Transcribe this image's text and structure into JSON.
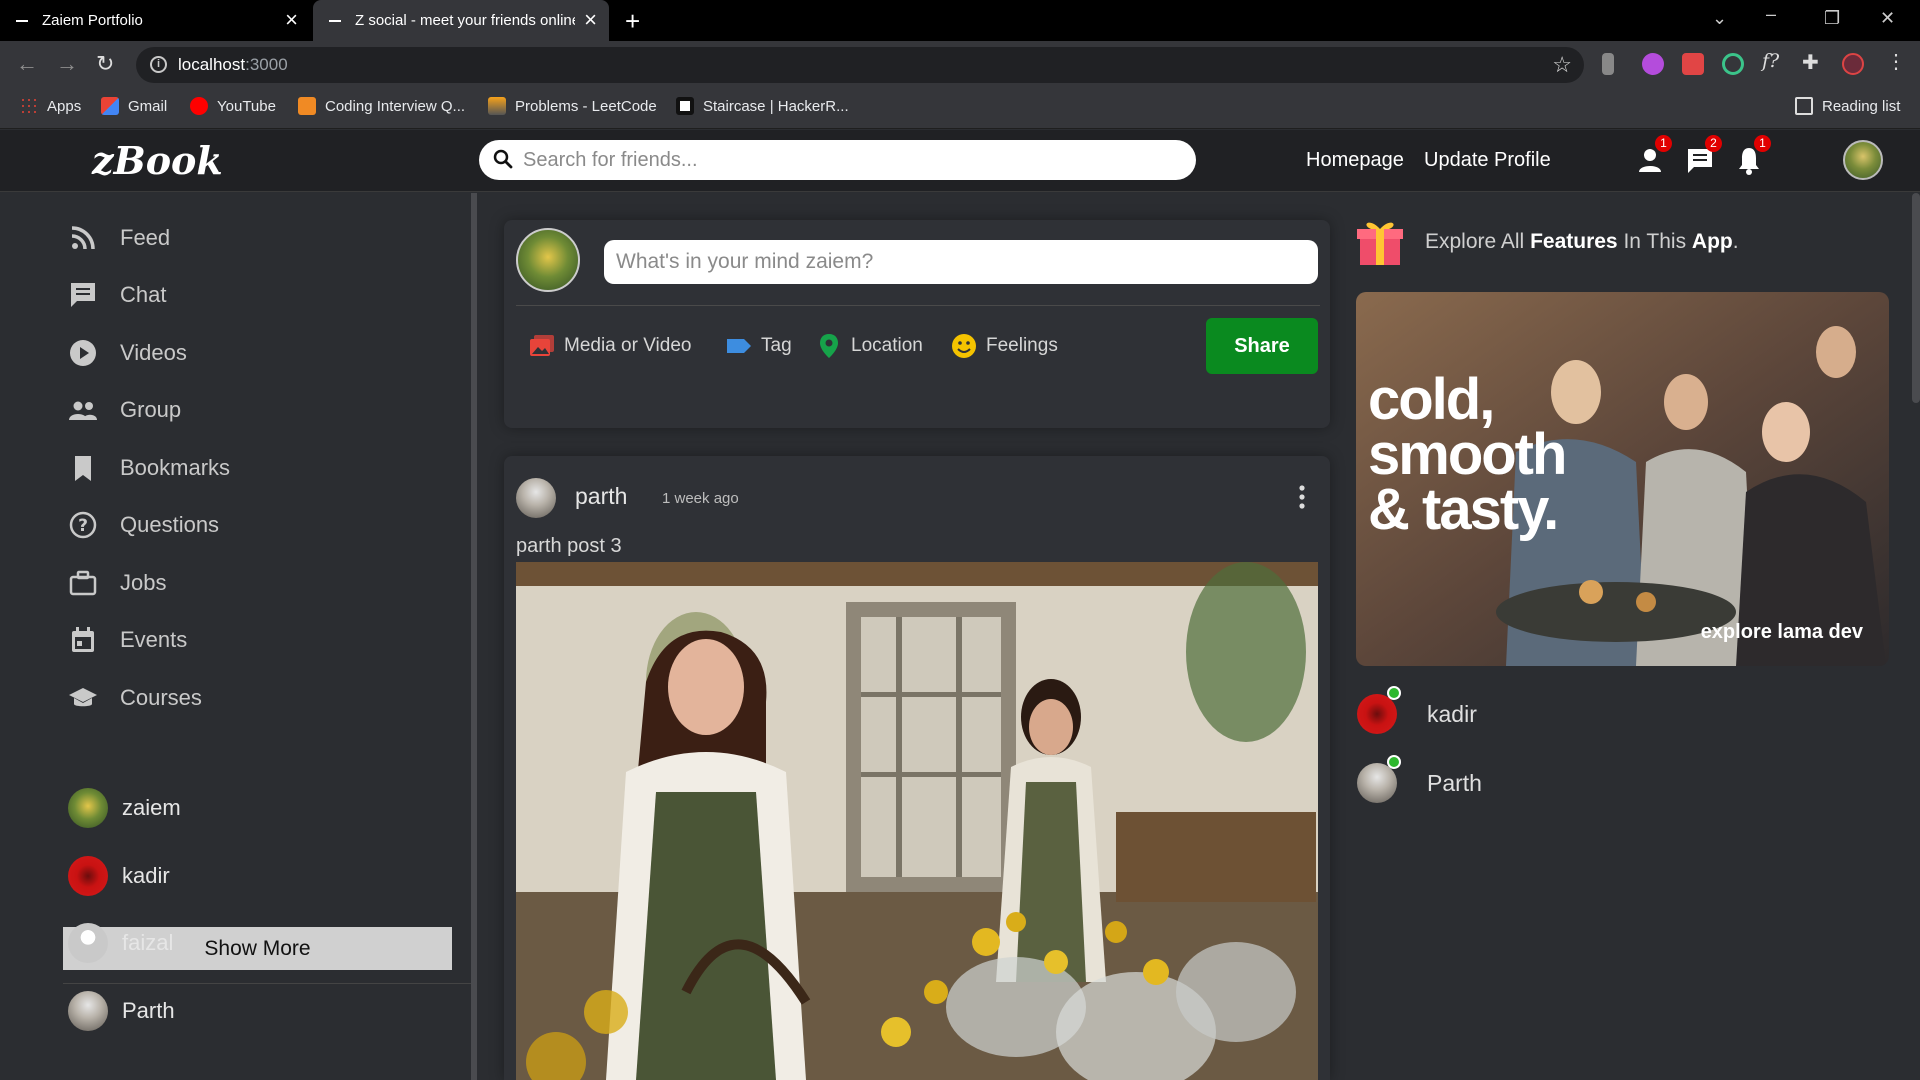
{
  "browser": {
    "tabs": [
      {
        "title": "Zaiem Portfolio"
      },
      {
        "title": "Z social - meet your friends online"
      }
    ],
    "url_host": "localhost",
    "url_port": ":3000",
    "bookmarks": [
      {
        "label": "Apps"
      },
      {
        "label": "Gmail"
      },
      {
        "label": "YouTube"
      },
      {
        "label": "Coding Interview Q..."
      },
      {
        "label": "Problems - LeetCode"
      },
      {
        "label": "Staircase | HackerR..."
      }
    ],
    "reading_list": "Reading list"
  },
  "topbar": {
    "logo": "zBook",
    "search_placeholder": "Search for friends...",
    "links": [
      "Homepage",
      "Update Profile"
    ],
    "badges": {
      "friends": "1",
      "messages": "2",
      "notifications": "1"
    }
  },
  "sidebar": {
    "items": [
      {
        "label": "Feed",
        "icon": "rss-icon"
      },
      {
        "label": "Chat",
        "icon": "chat-icon"
      },
      {
        "label": "Videos",
        "icon": "play-circle-icon"
      },
      {
        "label": "Group",
        "icon": "group-icon"
      },
      {
        "label": "Bookmarks",
        "icon": "bookmark-icon"
      },
      {
        "label": "Questions",
        "icon": "help-circle-icon"
      },
      {
        "label": "Jobs",
        "icon": "briefcase-icon"
      },
      {
        "label": "Events",
        "icon": "calendar-icon"
      },
      {
        "label": "Courses",
        "icon": "school-icon"
      }
    ],
    "show_more": "Show More",
    "friends": [
      {
        "name": "zaiem"
      },
      {
        "name": "kadir"
      },
      {
        "name": "faizal"
      },
      {
        "name": "Parth"
      }
    ]
  },
  "share": {
    "placeholder": "What's in your mind zaiem?",
    "options": [
      "Media or Video",
      "Tag",
      "Location",
      "Feelings"
    ],
    "button": "Share"
  },
  "post": {
    "username": "parth",
    "time": "1 week ago",
    "text": "parth post 3"
  },
  "rightbar": {
    "feature_pre": "Explore All ",
    "feature_bold1": "Features",
    "feature_mid": " In This ",
    "feature_bold2": "App",
    "feature_end": ".",
    "ad_line1": "cold,",
    "ad_line2": "smooth",
    "ad_line3": "& tasty.",
    "ad_tag": "explore lama dev",
    "online_friends": [
      {
        "name": "kadir"
      },
      {
        "name": "Parth"
      }
    ]
  },
  "colors": {
    "share_button": "#0a8a1f",
    "badge": "#e10000",
    "online_dot": "#2eb82e"
  }
}
